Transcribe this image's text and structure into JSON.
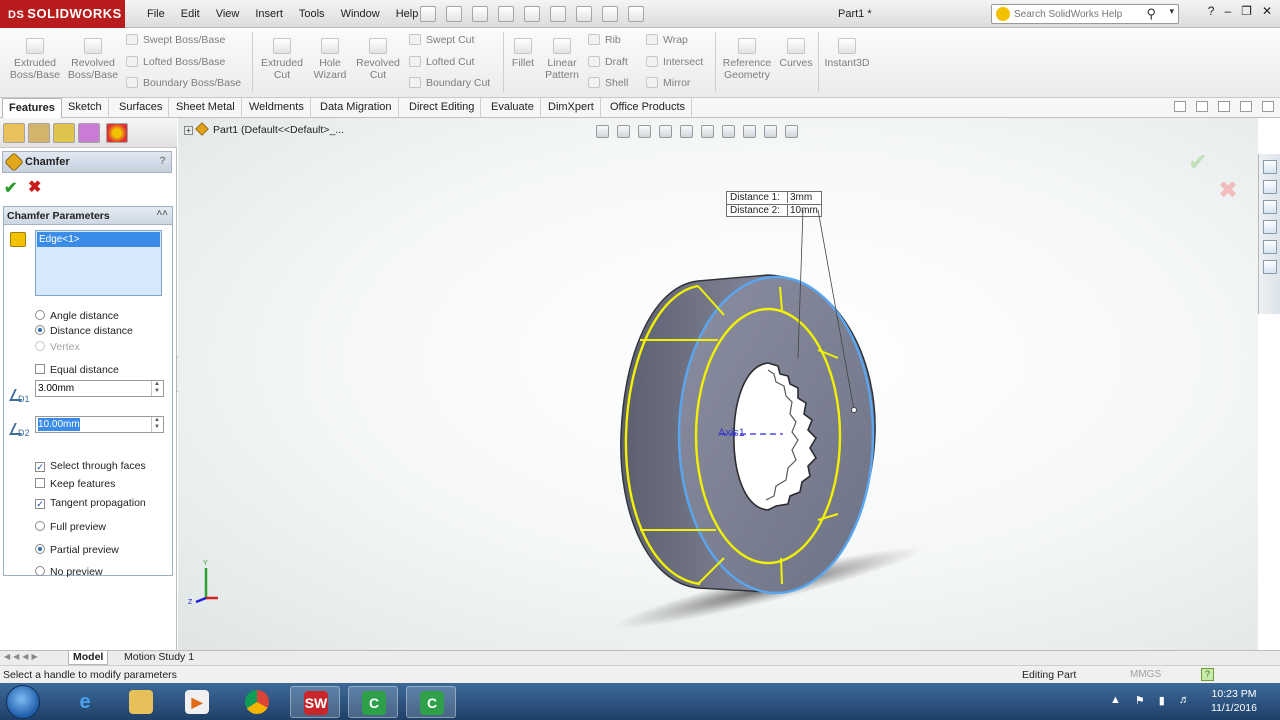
{
  "app": {
    "logo_text": "SOLIDWORKS",
    "ds_mark": "DS",
    "document_title": "Part1 *"
  },
  "menu": [
    "File",
    "Edit",
    "View",
    "Insert",
    "Tools",
    "Window",
    "Help"
  ],
  "search": {
    "placeholder": "Search SolidWorks Help"
  },
  "commands": {
    "extruded_boss": "Extruded Boss/Base",
    "revolved_boss": "Revolved Boss/Base",
    "swept_boss": "Swept Boss/Base",
    "lofted_boss": "Lofted Boss/Base",
    "boundary_boss": "Boundary Boss/Base",
    "extruded_cut": "Extruded Cut",
    "hole_wizard": "Hole Wizard",
    "revolved_cut": "Revolved Cut",
    "swept_cut": "Swept Cut",
    "lofted_cut": "Lofted Cut",
    "boundary_cut": "Boundary Cut",
    "fillet": "Fillet",
    "linear_pattern": "Linear Pattern",
    "rib": "Rib",
    "draft": "Draft",
    "shell": "Shell",
    "wrap": "Wrap",
    "intersect": "Intersect",
    "mirror": "Mirror",
    "reference_geometry": "Reference Geometry",
    "curves": "Curves",
    "instant3d": "Instant3D"
  },
  "tabs": [
    "Features",
    "Sketch",
    "Surfaces",
    "Sheet Metal",
    "Weldments",
    "Data Migration",
    "Direct Editing",
    "Evaluate",
    "DimXpert",
    "Office Products"
  ],
  "tree_path": "Part1  (Default<<Default>_...",
  "property_manager": {
    "title": "Chamfer",
    "help": "?",
    "group_title": "Chamfer Parameters",
    "selection": "Edge<1>",
    "options": {
      "angle_distance": "Angle distance",
      "distance_distance": "Distance distance",
      "vertex": "Vertex",
      "equal_distance": "Equal distance"
    },
    "d1_label": "D1",
    "d2_label": "D2",
    "distance1_value": "3.00mm",
    "distance2_value": "10.00mm",
    "checks": {
      "select_through_faces": "Select through faces",
      "keep_features": "Keep features",
      "tangent_propagation": "Tangent propagation"
    },
    "preview": {
      "full": "Full preview",
      "partial": "Partial preview",
      "none": "No preview"
    }
  },
  "callout": {
    "distance1_label": "Distance 1:",
    "distance1_value": "3mm",
    "distance2_label": "Distance 2:",
    "distance2_value": "10mm"
  },
  "axis_label": "Axis1",
  "bottom_tabs": {
    "model": "Model",
    "motion": "Motion Study 1"
  },
  "status": {
    "message": "Select a handle to modify parameters",
    "mode": "Editing Part",
    "units": "MMGS"
  },
  "clock": {
    "time": "10:23 PM",
    "date": "11/1/2016"
  },
  "colors": {
    "brand": "#b81c1c",
    "selection": "#3a8ce8",
    "edge_highlight": "#f2f200",
    "selected_edge": "#5aa6f0",
    "part": "#7a7f93"
  }
}
